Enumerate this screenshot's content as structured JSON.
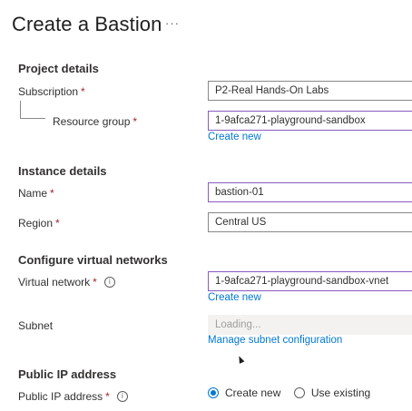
{
  "page": {
    "title": "Create a Bastion",
    "more_label": "···"
  },
  "project_details": {
    "heading": "Project details",
    "subscription": {
      "label": "Subscription",
      "required": "*",
      "value": "P2-Real Hands-On Labs"
    },
    "resource_group": {
      "label": "Resource group",
      "required": "*",
      "value": "1-9afca271-playground-sandbox",
      "link": "Create new"
    }
  },
  "instance_details": {
    "heading": "Instance details",
    "name": {
      "label": "Name",
      "required": "*",
      "value": "bastion-01"
    },
    "region": {
      "label": "Region",
      "required": "*",
      "value": "Central US"
    }
  },
  "virtual_networks": {
    "heading": "Configure virtual networks",
    "virtual_network": {
      "label": "Virtual network",
      "required": "*",
      "info_icon": "i",
      "value": "1-9afca271-playground-sandbox-vnet",
      "link": "Create new"
    },
    "subnet": {
      "label": "Subnet",
      "placeholder": "Loading...",
      "link": "Manage subnet configuration"
    }
  },
  "public_ip": {
    "heading": "Public IP address",
    "public_ip_address": {
      "label": "Public IP address",
      "required": "*",
      "info_icon": "i",
      "options": [
        "Create new",
        "Use existing"
      ],
      "selected": "Create new"
    }
  },
  "colors": {
    "link": "#0078d4",
    "required": "#a4262c",
    "focus_border": "#8a5bbf",
    "radio_checked": "#0078d4"
  }
}
